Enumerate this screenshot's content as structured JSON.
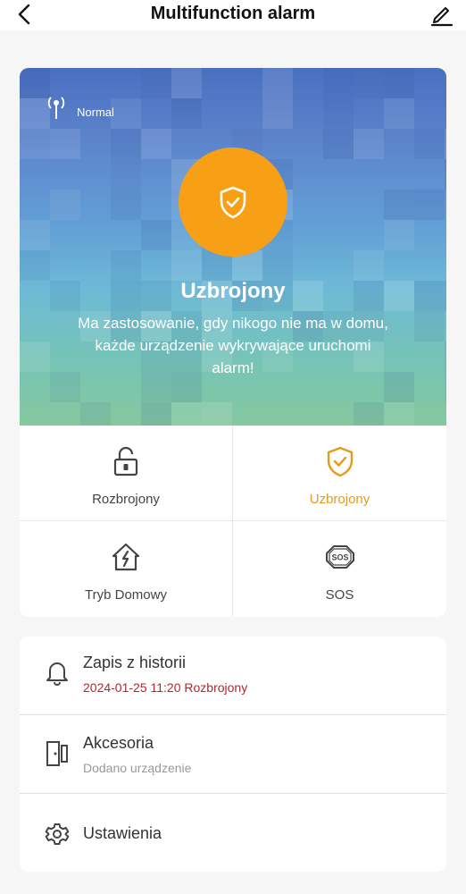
{
  "header": {
    "title": "Multifunction alarm",
    "back_icon": "chevron-left-icon",
    "edit_icon": "pencil-icon"
  },
  "hero": {
    "signal_label": "Normal",
    "signal_icon": "antenna-icon",
    "status_title": "Uzbrojony",
    "description": "Ma zastosowanie, gdy nikogo nie ma w domu, każde urządzenie wykrywające uruchomi alarm!",
    "badge_color": "#f8a015"
  },
  "modes": [
    {
      "label": "Rozbrojony",
      "icon": "unlock-icon",
      "active": false
    },
    {
      "label": "Uzbrojony",
      "icon": "shield-check-icon",
      "active": true
    },
    {
      "label": "Tryb Domowy",
      "icon": "home-bolt-icon",
      "active": false
    },
    {
      "label": "SOS",
      "icon": "sos-icon",
      "active": false
    }
  ],
  "list": {
    "history": {
      "title": "Zapis z historii",
      "subtitle": "2024-01-25 11:20 Rozbrojony",
      "icon": "bell-icon"
    },
    "accessories": {
      "title": "Akcesoria",
      "subtitle": "Dodano urządzenie",
      "icon": "device-icon"
    },
    "settings": {
      "title": "Ustawienia",
      "icon": "gear-icon"
    }
  },
  "colors": {
    "accent": "#e59a1a",
    "alert_text": "#b0282e"
  }
}
